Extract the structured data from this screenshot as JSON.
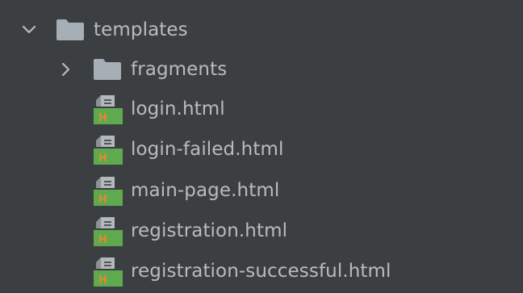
{
  "tree": {
    "root": {
      "label": "templates",
      "expanded": true,
      "icon": "folder-icon",
      "toggle_icon": "chevron-down-icon"
    },
    "children": [
      {
        "type": "folder",
        "label": "fragments",
        "expanded": false,
        "icon": "folder-icon",
        "toggle_icon": "chevron-right-icon"
      },
      {
        "type": "file",
        "label": "login.html",
        "icon": "html-file-icon"
      },
      {
        "type": "file",
        "label": "login-failed.html",
        "icon": "html-file-icon"
      },
      {
        "type": "file",
        "label": "main-page.html",
        "icon": "html-file-icon"
      },
      {
        "type": "file",
        "label": "registration.html",
        "icon": "html-file-icon"
      },
      {
        "type": "file",
        "label": "registration-successful.html",
        "icon": "html-file-icon"
      }
    ]
  },
  "colors": {
    "background": "#3c3f41",
    "text": "#bbbbbb",
    "folder": "#a6aeb6",
    "chevron": "#b9bcbf",
    "html_badge": "#5fa94f",
    "html_letter": "#e08a2e",
    "file_doc": "#b3b8bd"
  }
}
